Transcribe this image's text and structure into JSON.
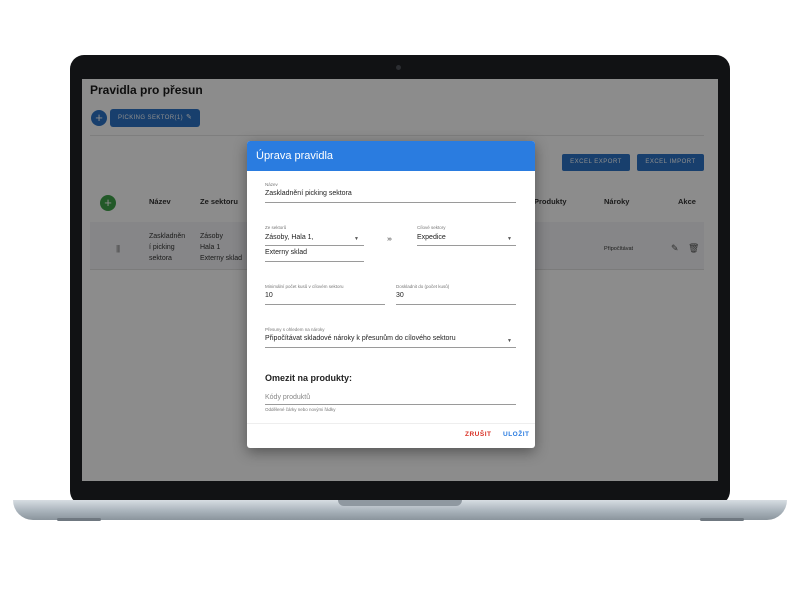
{
  "app": {
    "title": "Pravidla pro přesun",
    "chip_label": "PICKING SEKTOR(1)",
    "add_icon": "plus-icon",
    "edit_icon": "pencil-icon",
    "excel_export": "EXCEL EXPORT",
    "excel_import": "EXCEL IMPORT"
  },
  "table": {
    "columns": [
      "Název",
      "Ze sektoru",
      "Produkty",
      "Nároky",
      "Akce"
    ],
    "rows": [
      {
        "nazev": [
          "Zaskladněn",
          "í picking",
          "sektora"
        ],
        "ze_sektoru": [
          "Zásoby",
          "Hala 1",
          "Externy sklad"
        ],
        "naroky": "Připočítávat",
        "actions": [
          "edit-icon",
          "delete-icon"
        ]
      }
    ]
  },
  "dialog": {
    "title": "Úprava pravidla",
    "name_label": "Název",
    "name_value": "Zaskladnění picking sektora",
    "from_label": "Ze sektorů",
    "from_value_line1": "Zásoby, Hala 1,",
    "from_value_line2": "Externy sklad",
    "target_label": "Cílové sektory",
    "target_value": "Expedice",
    "min_label": "Minimální počet kusů v cílovém sektoru",
    "min_value": "10",
    "fill_label": "Doskladnit do (počet kusů)",
    "fill_value": "30",
    "moves_label": "Přesuny s ohledem na nároky",
    "moves_value": "Připočítávat skladové nároky k přesunům do cílového sektoru",
    "restrict_heading": "Omezit na produkty:",
    "codes_placeholder": "Kódy produktů",
    "codes_hint": "Oddělené čárky nebo novými řádky",
    "cancel": "ZRUŠIT",
    "save": "ULOŽIT"
  },
  "colors": {
    "primary": "#2a7ce0",
    "add_green": "#3fa24a",
    "cancel_red": "#d93025"
  }
}
